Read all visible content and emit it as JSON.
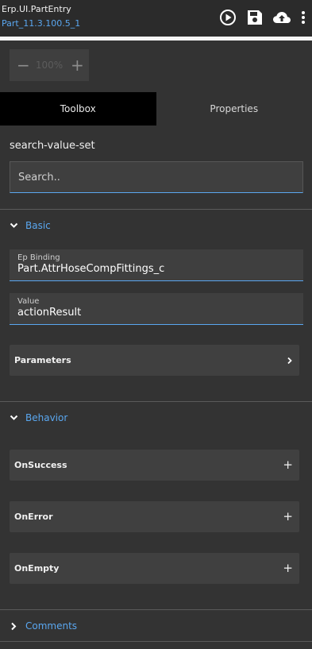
{
  "header": {
    "title": "Erp.UI.PartEntry",
    "subtitle": "Part_11.3.100.5_1",
    "icons": [
      "play-circle-icon",
      "save-icon",
      "cloud-upload-icon",
      "more-vertical-icon"
    ]
  },
  "zoom": {
    "minus": "−",
    "value": "100%",
    "plus": "+"
  },
  "tabs": [
    {
      "label": "Toolbox",
      "active": true
    },
    {
      "label": "Properties",
      "active": false
    }
  ],
  "component": {
    "name": "search-value-set"
  },
  "search": {
    "placeholder": "Search.."
  },
  "basic": {
    "label": "Basic",
    "ep_binding": {
      "label": "Ep Binding",
      "value": "Part.AttrHoseCompFittings_c"
    },
    "value_field": {
      "label": "Value",
      "value": "actionResult"
    },
    "parameters": {
      "label": "Parameters",
      "icon": "chevron-right-icon"
    }
  },
  "behavior": {
    "label": "Behavior",
    "events": [
      {
        "label": "OnSuccess",
        "icon": "plus-icon"
      },
      {
        "label": "OnError",
        "icon": "plus-icon"
      },
      {
        "label": "OnEmpty",
        "icon": "plus-icon"
      }
    ]
  },
  "comments": {
    "label": "Comments"
  },
  "colors": {
    "accent": "#5aa7f0",
    "background": "#333333",
    "panel": "#3f3f3f",
    "active_tab": "#000000"
  }
}
